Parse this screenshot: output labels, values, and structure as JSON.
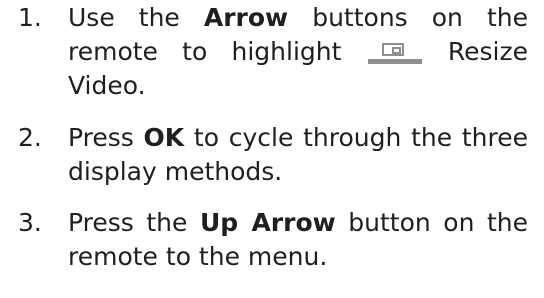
{
  "steps": [
    {
      "number": "1.",
      "pre": "Use the ",
      "bold1": "Arrow",
      "mid": " buttons on the remote to highlight ",
      "icon": "resize-video-icon",
      "post": " Resize Video."
    },
    {
      "number": "2.",
      "pre": "Press ",
      "bold1": "OK",
      "post": " to cycle through the three display methods."
    },
    {
      "number": "3.",
      "pre": "Press the ",
      "bold1": "Up Arrow",
      "post": " button on the remote to the menu."
    }
  ],
  "colors": {
    "text": "#1f1f1f",
    "icon": "#8f8f8f"
  }
}
